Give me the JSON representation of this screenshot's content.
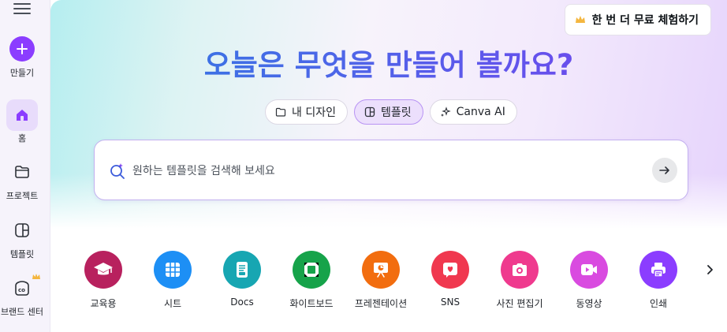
{
  "sidebar": {
    "create_label": "만들기",
    "items": [
      {
        "label": "홈",
        "icon": "home-icon"
      },
      {
        "label": "프로젝트",
        "icon": "folder-icon"
      },
      {
        "label": "템플릿",
        "icon": "template-icon"
      },
      {
        "label": "브랜드 센터",
        "icon": "brand-icon"
      }
    ]
  },
  "header": {
    "trial_button": "한 번 더 무료 체험하기"
  },
  "hero": {
    "title": "오늘은 무엇을 만들어 볼까요?",
    "tabs": [
      {
        "label": "내 디자인",
        "icon": "folder-icon",
        "active": false
      },
      {
        "label": "템플릿",
        "icon": "template-icon",
        "active": true
      },
      {
        "label": "Canva AI",
        "icon": "sparkle-icon",
        "active": false
      }
    ]
  },
  "search": {
    "placeholder": "원하는 템플릿을 검색해 보세요"
  },
  "categories": [
    {
      "label": "교육용",
      "color": "#b8215e",
      "icon": "graduation-cap-icon"
    },
    {
      "label": "시트",
      "color": "#1d8ff5",
      "icon": "sheet-icon"
    },
    {
      "label": "Docs",
      "color": "#17a6b2",
      "icon": "docs-icon"
    },
    {
      "label": "화이트보드",
      "color": "#16a34a",
      "icon": "whiteboard-icon"
    },
    {
      "label": "프레젠테이션",
      "color": "#f26d0f",
      "icon": "presentation-icon"
    },
    {
      "label": "SNS",
      "color": "#f0384f",
      "icon": "heart-icon"
    },
    {
      "label": "사진 편집기",
      "color": "#ef3a8e",
      "icon": "camera-icon"
    },
    {
      "label": "동영상",
      "color": "#d94be0",
      "icon": "video-icon"
    },
    {
      "label": "인쇄",
      "color": "#8b3dff",
      "icon": "printer-icon"
    }
  ]
}
